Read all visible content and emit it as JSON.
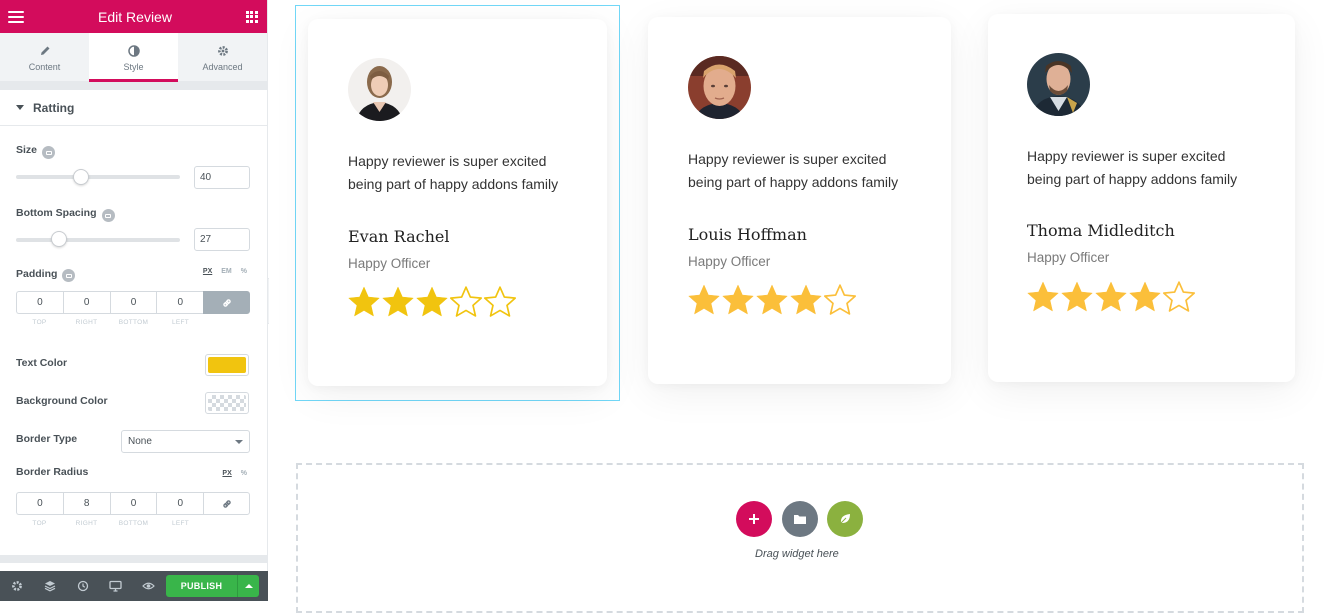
{
  "panel": {
    "title": "Edit Review",
    "tabs": [
      {
        "label": "Content",
        "icon": "pencil-icon"
      },
      {
        "label": "Style",
        "icon": "contrast-icon"
      },
      {
        "label": "Advanced",
        "icon": "gear-icon"
      }
    ],
    "active_tab": "Style",
    "section_title": "Ratting",
    "size": {
      "label": "Size",
      "value": "40",
      "slider_fraction": 0.4
    },
    "bottom_spacing": {
      "label": "Bottom Spacing",
      "value": "27",
      "slider_fraction": 0.27
    },
    "padding": {
      "label": "Padding",
      "units": [
        "PX",
        "EM",
        "%"
      ],
      "active_unit": "PX",
      "values": [
        "0",
        "0",
        "0",
        "0"
      ],
      "sides": [
        "TOP",
        "RIGHT",
        "BOTTOM",
        "LEFT"
      ],
      "linked": true
    },
    "text_color": {
      "label": "Text Color",
      "value": "#f1c40f"
    },
    "background_color": {
      "label": "Background Color"
    },
    "border_type": {
      "label": "Border Type",
      "value": "None"
    },
    "border_radius": {
      "label": "Border Radius",
      "units": [
        "PX",
        "%"
      ],
      "active_unit": "PX",
      "values": [
        "0",
        "8",
        "0",
        "0"
      ],
      "sides": [
        "TOP",
        "RIGHT",
        "BOTTOM",
        "LEFT"
      ],
      "linked": false
    },
    "publish_label": "PUBLISH"
  },
  "reviews": [
    {
      "text_line1": "Happy reviewer is super excited",
      "text_line2": "being part of happy addons family",
      "name": "Evan Rachel",
      "title": "Happy Officer",
      "rating": 3,
      "max": 5,
      "star_color": "#f1c40f"
    },
    {
      "text_line1": "Happy reviewer is super excited",
      "text_line2": "being part of happy addons family",
      "name": "Louis Hoffman",
      "title": "Happy Officer",
      "rating": 4,
      "max": 5,
      "star_color": "#fbbf3a"
    },
    {
      "text_line1": "Happy reviewer is super excited",
      "text_line2": "being part of happy addons family",
      "name": "Thoma Midleditch",
      "title": "Happy Officer",
      "rating": 4,
      "max": 5,
      "star_color": "#fbbf3a"
    }
  ],
  "drop_zone": {
    "text": "Drag widget here"
  },
  "colors": {
    "brand": "#d30c5c",
    "publish": "#39b54a",
    "template_button": "#6d7882",
    "kit_button": "#8bb13f"
  }
}
